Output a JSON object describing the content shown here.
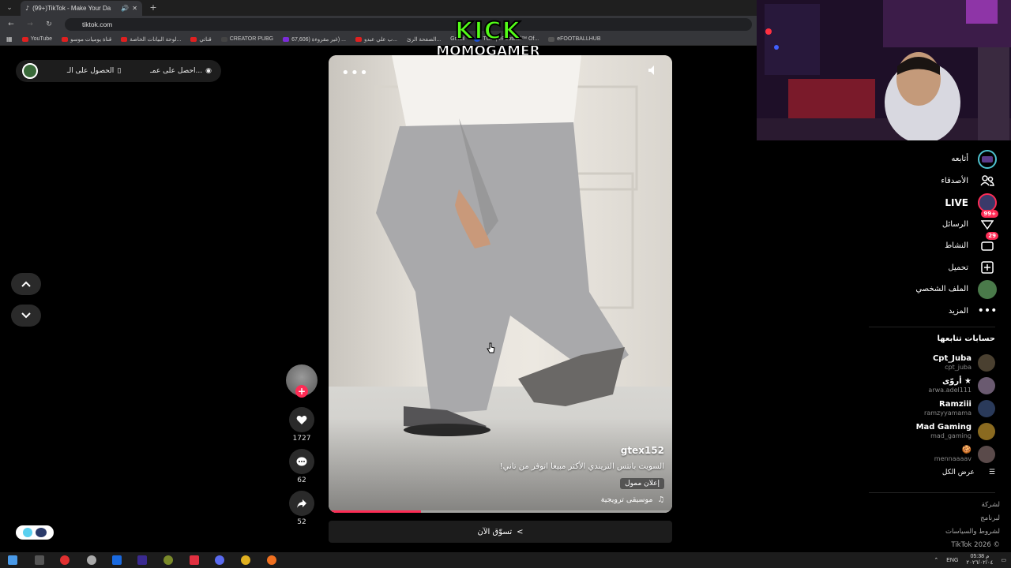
{
  "browser": {
    "tab_title": "(99+)TikTok - Make Your Da",
    "url": "tiktok.com",
    "bookmarks": [
      {
        "label": "YouTube"
      },
      {
        "label": "قناة يوميات موسو"
      },
      {
        "label": "لوحة البيانات الخاصة..."
      },
      {
        "label": "قناتي"
      },
      {
        "label": "CREATOR PUBG"
      },
      {
        "label": "67,606) غير مقروءة) ..."
      },
      {
        "label": "ب علي عبدو..."
      },
      {
        "label": "الصفحة الرئ..."
      },
      {
        "label": "Gmail"
      },
      {
        "label": "TOP | eFootball™ Of..."
      },
      {
        "label": "eFOOTBALLHUB"
      }
    ]
  },
  "overlay": {
    "kick_text": "KICK",
    "streamer_text": "MOMOGAMER"
  },
  "top_chip": {
    "item1": "الحصول على الـ",
    "item2": "احصل على عمـ..."
  },
  "video": {
    "username": "gtex152",
    "caption": "السويت بانتس التريندي الأكثر مبيعا اتوفر من تاني!",
    "ad_label": "إعلان ممول",
    "music": "موسيقى ترويجية",
    "progress": 0.27
  },
  "actions": {
    "likes": "1727",
    "comments": "62",
    "shares": "52"
  },
  "shop": {
    "label": "تسوّق الآن"
  },
  "sidebar": {
    "nav": [
      {
        "label": "أتابعه",
        "icon": "following-icon"
      },
      {
        "label": "الأصدقاء",
        "icon": "friends-icon"
      },
      {
        "label": "LIVE",
        "icon": "live-icon"
      },
      {
        "label": "الرسائل",
        "icon": "messages-icon",
        "badge": "99+"
      },
      {
        "label": "النشاط",
        "icon": "activity-icon",
        "badge": "29"
      },
      {
        "label": "تحميل",
        "icon": "upload-icon"
      },
      {
        "label": "الملف الشخصي",
        "icon": "profile-icon"
      },
      {
        "label": "المزيد",
        "icon": "more-icon"
      }
    ],
    "following_title": "حسابات تتابعها",
    "following": [
      {
        "name": "Cpt_Juba",
        "user": "cpt_juba",
        "color": "#4a4030"
      },
      {
        "name": "أروّى ★",
        "user": "arwa.adel111",
        "color": "#6a5a70"
      },
      {
        "name": "Ramziii",
        "user": "ramzyyamama",
        "color": "#2a3a5a"
      },
      {
        "name": "Mad Gaming",
        "user": "mad_gaming",
        "color": "#8a6a20"
      },
      {
        "name": "🍪",
        "user": "mennaaaav",
        "color": "#5a4a4a"
      }
    ],
    "see_all": "عرض الكل",
    "footer": [
      "لشركة",
      "لبرنامج",
      "لشروط والسياسات",
      "TikTok 2026 ©"
    ]
  },
  "taskbar": {
    "lang": "ENG",
    "time": "05:38 م",
    "date": "٢٠٢٦/٠٢/٠٤"
  },
  "colors": {
    "accent": "#fe2c55",
    "kick_green": "#53fc18"
  }
}
